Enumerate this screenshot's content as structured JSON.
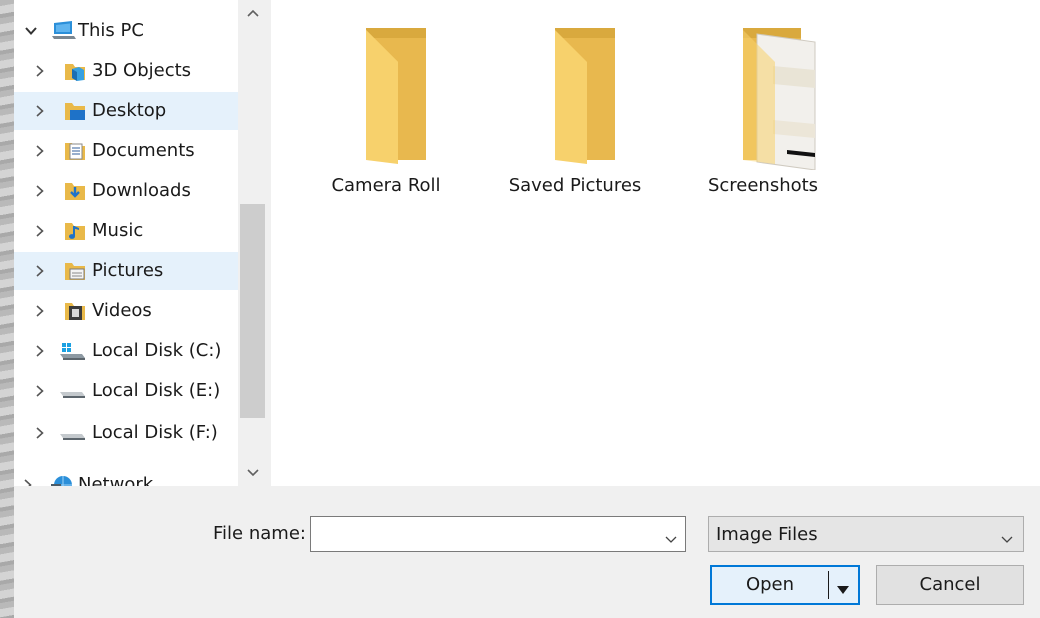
{
  "nav": {
    "items": [
      {
        "label": "This PC",
        "icon": "computer-icon",
        "expanded": true,
        "selected": false
      },
      {
        "label": "3D Objects",
        "icon": "3d-objects-icon",
        "selected": false
      },
      {
        "label": "Desktop",
        "icon": "desktop-folder-icon",
        "selected": true
      },
      {
        "label": "Documents",
        "icon": "documents-folder-icon",
        "selected": false
      },
      {
        "label": "Downloads",
        "icon": "downloads-folder-icon",
        "selected": false
      },
      {
        "label": "Music",
        "icon": "music-folder-icon",
        "selected": false
      },
      {
        "label": "Pictures",
        "icon": "pictures-folder-icon",
        "selected": true
      },
      {
        "label": "Videos",
        "icon": "videos-folder-icon",
        "selected": false
      },
      {
        "label": "Local Disk (C:)",
        "icon": "system-drive-icon",
        "selected": false
      },
      {
        "label": "Local Disk (E:)",
        "icon": "drive-icon",
        "selected": false
      },
      {
        "label": "Local Disk (F:)",
        "icon": "drive-icon",
        "selected": false
      },
      {
        "label": "Network",
        "icon": "network-icon",
        "selected": false
      }
    ]
  },
  "content": {
    "folders": [
      {
        "name": "Camera Roll"
      },
      {
        "name": "Saved Pictures"
      },
      {
        "name": "Screenshots"
      }
    ]
  },
  "bottom": {
    "file_name_label": "File name:",
    "file_name_value": "",
    "file_type": "Image Files",
    "open_label": "Open",
    "cancel_label": "Cancel"
  },
  "colors": {
    "selection": "#e5f1fb",
    "accent": "#0078d7",
    "folder": "#f8d775"
  }
}
